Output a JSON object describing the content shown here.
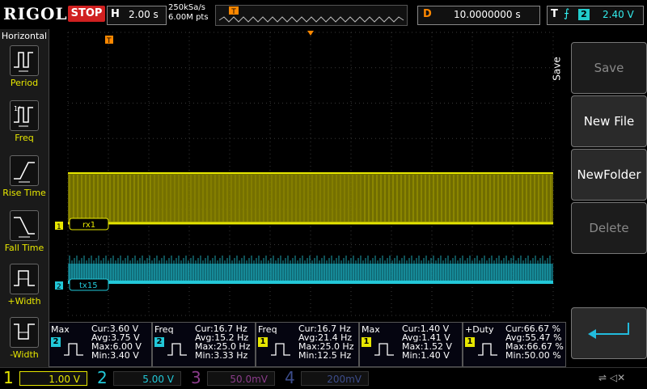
{
  "top": {
    "brand": "RIGOL",
    "run_state": "STOP",
    "h_label": "H",
    "timebase": "2.00 s",
    "sample_rate": "250kSa/s",
    "mem_depth": "6.00M pts",
    "trigger_pos_marker": "T",
    "d_label": "D",
    "delay": "10.0000000 s",
    "t_label": "T",
    "trig_channel": "2",
    "trig_level": "2.40 V"
  },
  "sidebar": {
    "title": "Horizontal",
    "items": [
      {
        "label": "Period",
        "icon": "period-icon"
      },
      {
        "label": "Freq",
        "icon": "freq-icon"
      },
      {
        "label": "Rise Time",
        "icon": "rise-time-icon"
      },
      {
        "label": "Fall Time",
        "icon": "fall-time-icon"
      },
      {
        "label": "+Width",
        "icon": "pos-width-icon"
      },
      {
        "label": "-Width",
        "icon": "neg-width-icon"
      }
    ]
  },
  "screen": {
    "ch1_label": "rx1",
    "ch2_label": "tx15",
    "ch1_marker": "1",
    "ch2_marker": "2",
    "trig_marker": "T",
    "colors": {
      "ch1": "#e6e600",
      "ch2": "#22c8d8",
      "grid": "#3a3a3a",
      "trigger": "#ff8800"
    }
  },
  "right_menu": {
    "tab": "Save",
    "buttons": [
      {
        "label": "Save",
        "enabled": false
      },
      {
        "label": "New File",
        "enabled": true
      },
      {
        "label": "NewFolder",
        "enabled": true
      },
      {
        "label": "Delete",
        "enabled": false
      }
    ],
    "enter_icon": "enter-arrow-icon"
  },
  "measurements": [
    {
      "type": "Max",
      "channel": "2",
      "cur": "Cur:3.60 V",
      "avg": "Avg:3.75 V",
      "max": "Max:6.00 V",
      "min": "Min:3.40 V"
    },
    {
      "type": "Freq",
      "channel": "2",
      "cur": "Cur:16.7 Hz",
      "avg": "Avg:15.2 Hz",
      "max": "Max:25.0 Hz",
      "min": "Min:3.33 Hz"
    },
    {
      "type": "Freq",
      "channel": "1",
      "cur": "Cur:16.7 Hz",
      "avg": "Avg:21.4 Hz",
      "max": "Max:25.0 Hz",
      "min": "Min:12.5 Hz"
    },
    {
      "type": "Max",
      "channel": "1",
      "cur": "Cur:1.40 V",
      "avg": "Avg:1.41 V",
      "max": "Max:1.52 V",
      "min": "Min:1.40 V"
    },
    {
      "type": "+Duty",
      "channel": "1",
      "cur": "Cur:66.67 %",
      "avg": "Avg:55.47 %",
      "max": "Max:66.67 %",
      "min": "Min:50.00 %"
    }
  ],
  "bottom": {
    "channels": [
      {
        "num": "1",
        "scale": "1.00 V",
        "color": "#e6e600"
      },
      {
        "num": "2",
        "scale": "5.00 V",
        "color": "#22c8d8"
      },
      {
        "num": "3",
        "scale": "50.0mV",
        "color": "#8a3c8a"
      },
      {
        "num": "4",
        "scale": "200mV",
        "color": "#3c4c8a"
      }
    ],
    "usb_icon": "usb-icon",
    "sound_icon": "mute-icon"
  }
}
